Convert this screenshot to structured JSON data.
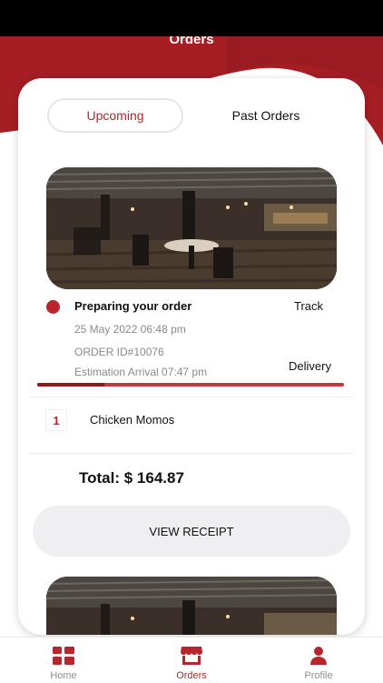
{
  "header": {
    "title": "Orders"
  },
  "tabs": {
    "upcoming": "Upcoming",
    "past": "Past Orders"
  },
  "order": {
    "status": "Preparing your order",
    "track_label": "Track",
    "date": "25 May 2022 06:48 pm",
    "order_id": "ORDER ID#10076",
    "eta_label": "Estimation Arrival  07:47 pm",
    "delivery_label": "Delivery",
    "progress_percent": 22,
    "items": [
      {
        "qty": "1",
        "name": "Chicken Momos"
      }
    ],
    "total": "Total: $ 164.87",
    "receipt_button": "VIEW RECEIPT"
  },
  "nav": {
    "home": "Home",
    "orders": "Orders",
    "profile": "Profile"
  },
  "colors": {
    "accent": "#b8252c",
    "header_bg": "#a41e24",
    "inactive": "#8e8e8e"
  },
  "icons": {
    "home": "grid-icon",
    "orders": "store-icon",
    "profile": "person-icon",
    "status": "status-dot-icon"
  }
}
